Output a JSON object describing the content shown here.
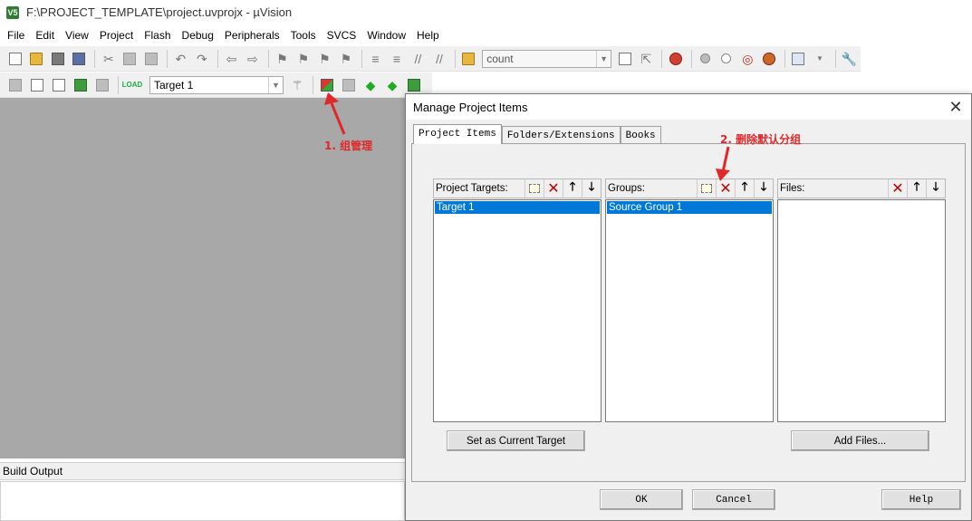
{
  "window": {
    "title": "F:\\PROJECT_TEMPLATE\\project.uvprojx - µVision",
    "app_icon": "V5"
  },
  "menu": [
    "File",
    "Edit",
    "View",
    "Project",
    "Flash",
    "Debug",
    "Peripherals",
    "Tools",
    "SVCS",
    "Window",
    "Help"
  ],
  "toolbar": {
    "find_combo_value": "count",
    "target_combo_value": "Target 1"
  },
  "workspace": {
    "build_output_title": "Build Output"
  },
  "annotations": {
    "step1": "1. 组管理",
    "step2": "2. 删除默认分组",
    "color": "#e02828"
  },
  "dialog": {
    "title": "Manage Project Items",
    "tabs": [
      "Project Items",
      "Folders/Extensions",
      "Books"
    ],
    "active_tab": "Project Items",
    "panels": {
      "targets": {
        "label": "Project Targets:",
        "items": [
          "Target 1"
        ],
        "selected": "Target 1"
      },
      "groups": {
        "label": "Groups:",
        "items": [
          "Source Group 1"
        ],
        "selected": "Source Group 1"
      },
      "files": {
        "label": "Files:",
        "items": []
      }
    },
    "buttons": {
      "set_current_target": "Set as Current Target",
      "add_files": "Add Files...",
      "ok": "OK",
      "cancel": "Cancel",
      "help": "Help"
    }
  },
  "colors": {
    "selection": "#0078d7",
    "workspace_bg": "#a8a8a8",
    "delete_red": "#c00000"
  }
}
